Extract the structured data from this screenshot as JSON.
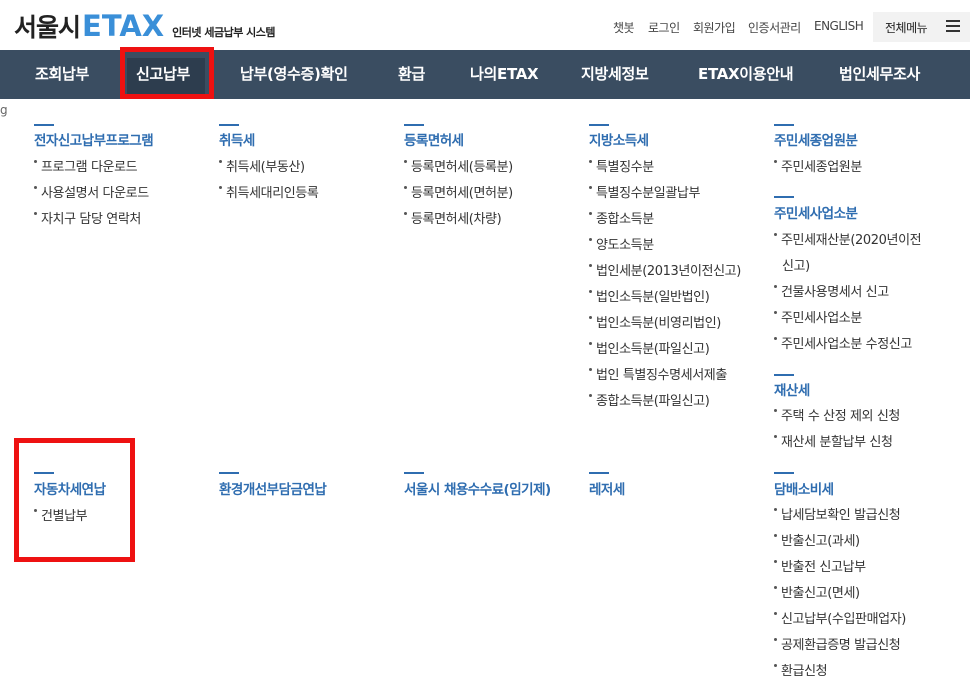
{
  "header": {
    "logo_seoul": "서울시",
    "logo_etax": "ETAX",
    "logo_sub": "인터넷 세금납부 시스템",
    "util_links": [
      "챗봇",
      "로그인",
      "회원가입",
      "인증서관리",
      "ENGLISH"
    ],
    "all_menu_label": "전체메뉴"
  },
  "nav": {
    "items": [
      "조회납부",
      "신고납부",
      "납부(영수증)확인",
      "환급",
      "나의ETAX",
      "지방세정보",
      "ETAX이용안내",
      "법인세무조사"
    ],
    "active": "신고납부"
  },
  "edge_char": "g",
  "dropdown": {
    "e_filing": {
      "title": "전자신고납부프로그램",
      "links": [
        "프로그램 다운로드",
        "사용설명서 다운로드",
        "자치구 담당 연락처"
      ]
    },
    "acquisition": {
      "title": "취득세",
      "links": [
        "취득세(부동산)",
        "취득세대리인등록"
      ]
    },
    "registration": {
      "title": "등록면허세",
      "links": [
        "등록면허세(등록분)",
        "등록면허세(면허분)",
        "등록면허세(차량)"
      ]
    },
    "local_income": {
      "title": "지방소득세",
      "links": [
        "특별징수분",
        "특별징수분일괄납부",
        "종합소득분",
        "양도소득분",
        "법인세분(2013년이전신고)",
        "법인소득분(일반법인)",
        "법인소득분(비영리법인)",
        "법인소득분(파일신고)",
        "법인 특별징수명세서제출",
        "종합소득분(파일신고)"
      ]
    },
    "resident_employee": {
      "title": "주민세종업원분",
      "links": [
        "주민세종업원분"
      ]
    },
    "resident_business": {
      "title": "주민세사업소분",
      "links": [
        "주민세재산분(2020년이전",
        "신고)",
        "건물사용명세서 신고",
        "주민세사업소분",
        "주민세사업소분 수정신고"
      ]
    },
    "property": {
      "title": "재산세",
      "links": [
        "주택 수 산정 제외 신청",
        "재산세 분할납부 신청"
      ]
    },
    "vehicle": {
      "title": "자동차세연납",
      "links": [
        "건별납부"
      ]
    },
    "environment": {
      "title": "환경개선부담금연납"
    },
    "employment": {
      "title": "서울시 채용수수료(임기제)"
    },
    "leisure": {
      "title": "레저세"
    },
    "tobacco": {
      "title": "담배소비세",
      "links": [
        "납세담보확인 발급신청",
        "반출신고(과세)",
        "반출전 신고납부",
        "반출신고(면세)",
        "신고납부(수입판매업자)",
        "공제환급증명 발급신청",
        "환급신청"
      ]
    }
  }
}
